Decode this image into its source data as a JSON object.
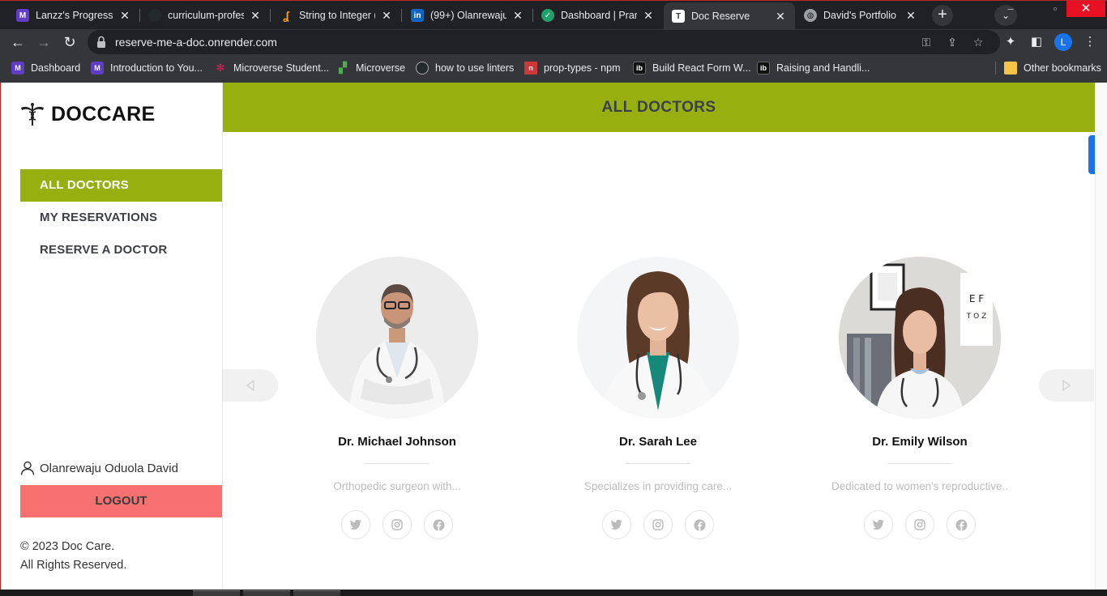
{
  "browser": {
    "tabs": [
      {
        "title": "Lanzz's Progress",
        "icon": "microverse-icon",
        "color": "#5f3dc4"
      },
      {
        "title": "curriculum-profes",
        "icon": "github-icon",
        "color": "#24292e"
      },
      {
        "title": "String to Integer (a",
        "icon": "leetcode-icon",
        "color": "#f89f1b"
      },
      {
        "title": "(99+) Olanrewaju (",
        "icon": "linkedin-icon",
        "color": "#0a66c2"
      },
      {
        "title": "Dashboard | Pramp",
        "icon": "pramp-icon",
        "color": "#22a06b"
      },
      {
        "title": "Doc Reserve",
        "icon": "docreserve-icon",
        "color": "#ffffff"
      },
      {
        "title": "David's Portfolio",
        "icon": "globe-icon",
        "color": "#9aa0a6"
      }
    ],
    "active_tab": "Doc Reserve",
    "url": "reserve-me-a-doc.onrender.com",
    "profile_initial": "L",
    "bookmarks": [
      {
        "label": "Dashboard",
        "icon": "microverse-icon",
        "color": "#5f3dc4"
      },
      {
        "label": "Introduction to You...",
        "icon": "microverse-icon",
        "color": "#5f3dc4"
      },
      {
        "label": "Microverse Student...",
        "icon": "slack-icon",
        "color": "#e01e5a"
      },
      {
        "label": "Microverse",
        "icon": "microverse-leaf-icon",
        "color": "#4caf50"
      },
      {
        "label": "how to use linters",
        "icon": "github-icon",
        "color": "#24292e"
      },
      {
        "label": "prop-types - npm",
        "icon": "npm-icon",
        "color": "#cb3837"
      },
      {
        "label": "Build React Form W...",
        "icon": "ib-icon",
        "color": "#111111"
      },
      {
        "label": "Raising and Handli...",
        "icon": "ib-icon",
        "color": "#111111"
      }
    ],
    "other_bookmarks": "Other bookmarks"
  },
  "app": {
    "brand": "DOCCARE",
    "nav": [
      {
        "label": "ALL DOCTORS",
        "active": true
      },
      {
        "label": "MY RESERVATIONS",
        "active": false
      },
      {
        "label": "RESERVE A DOCTOR",
        "active": false
      }
    ],
    "user_name": "Olanrewaju Oduola David",
    "logout_label": "LOGOUT",
    "footer_line1": "© 2023 Doc Care.",
    "footer_line2": "All Rights Reserved.",
    "header_title": "ALL DOCTORS",
    "accent_color": "#97af0f",
    "logout_color": "#f87171",
    "doctors": [
      {
        "name": "Dr. Michael Johnson",
        "description": "Orthopedic surgeon with..."
      },
      {
        "name": "Dr. Sarah Lee",
        "description": "Specializes in providing care..."
      },
      {
        "name": "Dr. Emily Wilson",
        "description": "Dedicated to women's reproductive.."
      }
    ]
  }
}
